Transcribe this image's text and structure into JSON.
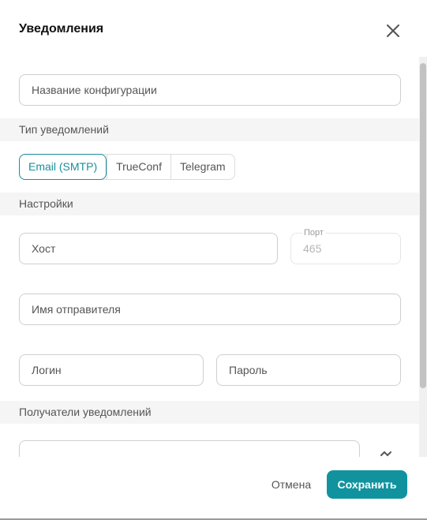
{
  "dialog": {
    "title": "Уведомления"
  },
  "config_name": {
    "placeholder": "Название конфигурации"
  },
  "notification_type": {
    "header": "Тип уведомлений",
    "options": [
      "Email (SMTP)",
      "TrueConf",
      "Telegram"
    ],
    "selected": "Email (SMTP)"
  },
  "settings": {
    "header": "Настройки",
    "host_placeholder": "Хост",
    "port_label": "Порт",
    "port_value": "465",
    "sender_placeholder": "Имя отправителя",
    "login_placeholder": "Логин",
    "password_placeholder": "Пароль"
  },
  "recipients": {
    "header": "Получатели уведомлений"
  },
  "footer": {
    "cancel_label": "Отмена",
    "save_label": "Сохранить"
  },
  "colors": {
    "accent": "#11939f",
    "active_tab": "#1a8f9a"
  }
}
